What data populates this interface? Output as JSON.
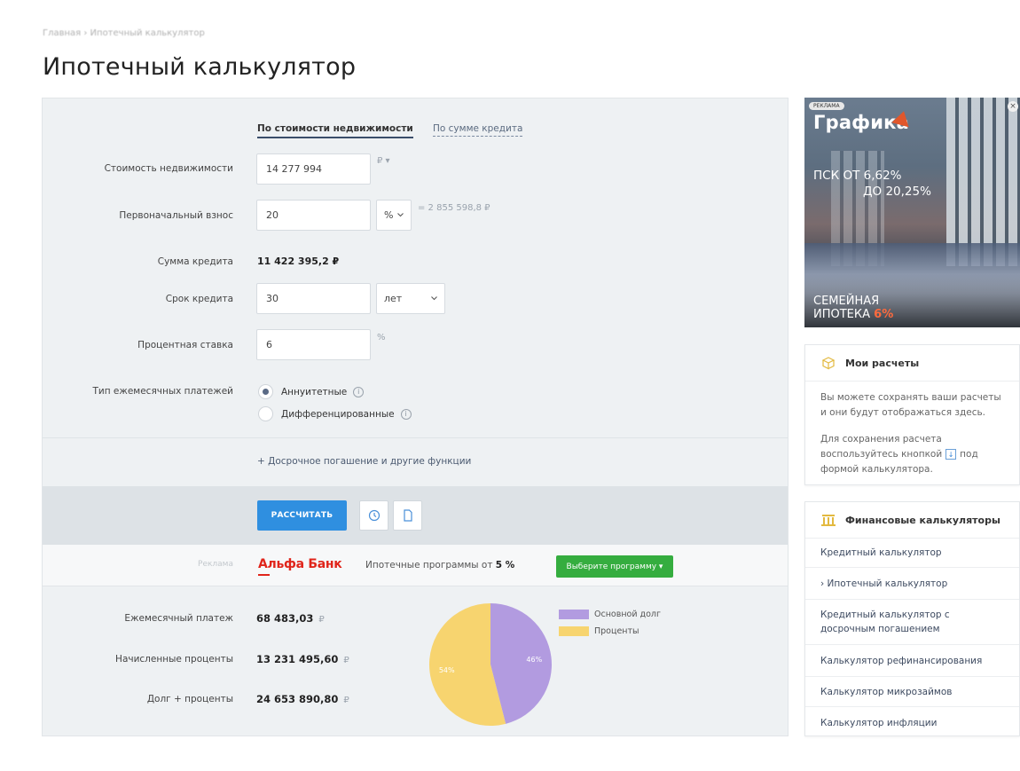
{
  "breadcrumb": "Главная › Ипотечный калькулятор",
  "page_title": "Ипотечный калькулятор",
  "mode_tabs": {
    "by_property": "По стоимости недвижимости",
    "by_loan": "По сумме кредита"
  },
  "form": {
    "property_cost": {
      "label": "Стоимость недвижимости",
      "value": "14 277 994",
      "unit": "₽ ▾"
    },
    "down_payment": {
      "label": "Первоначальный взнос",
      "value": "20",
      "unit": "%",
      "equals": "= 2 855 598,8 ₽"
    },
    "loan_sum": {
      "label": "Сумма кредита",
      "value": "11 422 395,2 ₽"
    },
    "term": {
      "label": "Срок кредита",
      "value": "30",
      "unit": "лет"
    },
    "rate": {
      "label": "Процентная ставка",
      "value": "6",
      "unit": "%"
    },
    "payment_type": {
      "label": "Тип ежемесячных платежей",
      "options": [
        "Аннуитетные",
        "Дифференцированные"
      ],
      "selected": "Аннуитетные"
    }
  },
  "extra_link": "+ Досрочное погашение и другие функции",
  "actions": {
    "calculate": "РАССЧИТАТЬ"
  },
  "ad": {
    "label": "Реклама",
    "bank": "Альфа Банк",
    "text_prefix": "Ипотечные программы от ",
    "rate": "5 %",
    "button": "Выберите программу ▾"
  },
  "results": {
    "monthly": {
      "label": "Ежемесячный платеж",
      "value": "68 483,03",
      "unit": "₽"
    },
    "interest": {
      "label": "Начисленные проценты",
      "value": "13 231 495,60",
      "unit": "₽"
    },
    "total": {
      "label": "Долг + проценты",
      "value": "24 653 890,80",
      "unit": "₽"
    }
  },
  "chart_data": {
    "type": "pie",
    "slices": [
      {
        "name": "Основной долг",
        "value": 46,
        "label": "46%",
        "color": "#b29be0"
      },
      {
        "name": "Проценты",
        "value": 54,
        "label": "54%",
        "color": "#f7d46f"
      }
    ],
    "legend": "right"
  },
  "banner": {
    "tag": "РЕКЛАМА",
    "brand": "Графика",
    "rate_line1": "ПСК ОТ 6,62%",
    "rate_line2": "ДО 20,25%",
    "promo_line1": "СЕМЕЙНАЯ",
    "promo_line2": "ИПОТЕКА ",
    "promo_accent": "6%"
  },
  "my_calcs": {
    "title": "Мои расчеты",
    "text1": "Вы можете сохранять ваши расчеты и они будут отображаться здесь.",
    "text2_before": "Для сохранения расчета воспользуйтесь кнопкой",
    "text2_after": "под формой калькулятора."
  },
  "fin_calcs": {
    "title": "Финансовые калькуляторы",
    "items": [
      "Кредитный калькулятор",
      "› Ипотечный калькулятор",
      "Кредитный калькулятор с досрочным погашением",
      "Калькулятор рефинансирования",
      "Калькулятор микрозаймов",
      "Калькулятор инфляции"
    ]
  },
  "colors": {
    "primary_button": "#2f8fe0",
    "green_button": "#35ad3f",
    "alfa_red": "#e0251b"
  }
}
